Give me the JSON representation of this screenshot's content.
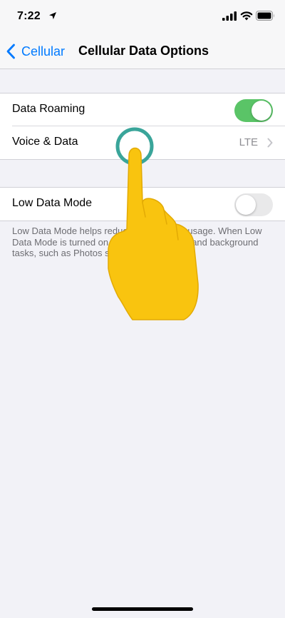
{
  "status_bar": {
    "time": "7:22"
  },
  "nav": {
    "back_label": "Cellular",
    "title": "Cellular Data Options"
  },
  "rows": {
    "data_roaming": {
      "label": "Data Roaming",
      "toggle": "on"
    },
    "voice_data": {
      "label": "Voice & Data",
      "value": "LTE"
    },
    "low_data_mode": {
      "label": "Low Data Mode",
      "toggle": "off"
    }
  },
  "footer_note": "Low Data Mode helps reduce cellular data usage. When Low Data Mode is turned on, automatic updates and background tasks, such as Photos syncing, are paused.",
  "colors": {
    "accent": "#007aff",
    "toggle_on": "#5ac467",
    "hand": "#f9c40f",
    "tap_ring": "#3aa59a"
  },
  "icons": [
    "location-arrow-icon",
    "cellular-signal-icon",
    "wifi-icon",
    "battery-icon",
    "chevron-left-icon",
    "chevron-right-icon",
    "tap-hand-icon"
  ]
}
